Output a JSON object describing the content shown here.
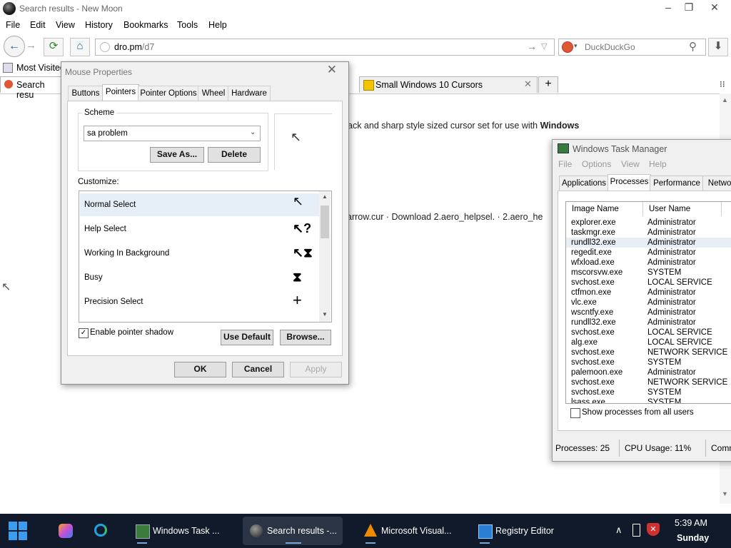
{
  "browser": {
    "title": "Search results - New Moon",
    "window_controls": {
      "minimize": "–",
      "restore": "❐",
      "close": "✕"
    },
    "menu": [
      "File",
      "Edit",
      "View",
      "History",
      "Bookmarks",
      "Tools",
      "Help"
    ],
    "url_host": "dro.pm",
    "url_path": "/d7",
    "search_engine": "DuckDuckGo",
    "bookmark_item": "Most Visited",
    "tabs": [
      {
        "label": "Search resu"
      },
      {
        "label": "Small Windows 10 Cursors"
      }
    ],
    "content_line1_prefix": "ack and sharp style sized cursor set for use with ",
    "content_line1_bold": "Windows",
    "content_line2": "arrow.cur · Download 2.aero_helpsel. · 2.aero_he"
  },
  "mouse_properties": {
    "title": "Mouse Properties",
    "tabs": [
      "Buttons",
      "Pointers",
      "Pointer Options",
      "Wheel",
      "Hardware"
    ],
    "active_tab": "Pointers",
    "scheme_label": "Scheme",
    "scheme_value": "sa problem",
    "save_as": "Save As...",
    "delete": "Delete",
    "customize_label": "Customize:",
    "cursor_rows": [
      {
        "label": "Normal Select",
        "glyph": "↖"
      },
      {
        "label": "Help Select",
        "glyph": "↖?"
      },
      {
        "label": "Working In Background",
        "glyph": "↖⧗"
      },
      {
        "label": "Busy",
        "glyph": "⧗"
      },
      {
        "label": "Precision Select",
        "glyph": "+"
      }
    ],
    "enable_shadow_label": "Enable pointer shadow",
    "enable_shadow_checked": true,
    "use_default": "Use Default",
    "browse": "Browse...",
    "ok": "OK",
    "cancel": "Cancel",
    "apply": "Apply"
  },
  "task_manager": {
    "title": "Windows Task Manager",
    "menu": [
      "File",
      "Options",
      "View",
      "Help"
    ],
    "tabs": [
      "Applications",
      "Processes",
      "Performance",
      "Networ"
    ],
    "active_tab": "Processes",
    "columns": [
      "Image Name",
      "User Name"
    ],
    "processes": [
      {
        "name": "explorer.exe",
        "user": "Administrator"
      },
      {
        "name": "taskmgr.exe",
        "user": "Administrator"
      },
      {
        "name": "rundll32.exe",
        "user": "Administrator"
      },
      {
        "name": "regedit.exe",
        "user": "Administrator"
      },
      {
        "name": "wfxload.exe",
        "user": "Administrator"
      },
      {
        "name": "mscorsvw.exe",
        "user": "SYSTEM"
      },
      {
        "name": "svchost.exe",
        "user": "LOCAL SERVICE"
      },
      {
        "name": "ctfmon.exe",
        "user": "Administrator"
      },
      {
        "name": "vlc.exe",
        "user": "Administrator"
      },
      {
        "name": "wscntfy.exe",
        "user": "Administrator"
      },
      {
        "name": "rundll32.exe",
        "user": "Administrator"
      },
      {
        "name": "svchost.exe",
        "user": "LOCAL SERVICE"
      },
      {
        "name": "alg.exe",
        "user": "LOCAL SERVICE"
      },
      {
        "name": "svchost.exe",
        "user": "NETWORK SERVICE"
      },
      {
        "name": "svchost.exe",
        "user": "SYSTEM"
      },
      {
        "name": "palemoon.exe",
        "user": "Administrator"
      },
      {
        "name": "svchost.exe",
        "user": "NETWORK SERVICE"
      },
      {
        "name": "svchost.exe",
        "user": "SYSTEM"
      },
      {
        "name": "lsass.exe",
        "user": "SYSTEM"
      }
    ],
    "selected_row": 2,
    "show_all_label": "Show processes from all users",
    "status_processes": "Processes: 25",
    "status_cpu": "CPU Usage: 11%",
    "status_commit": "Comm"
  },
  "taskbar": {
    "items": [
      {
        "label": "Windows Task ..."
      },
      {
        "label": "Search results -..."
      },
      {
        "label": "Microsoft Visual..."
      },
      {
        "label": "Registry Editor"
      }
    ],
    "time": "5:39 AM",
    "day": "Sunday"
  }
}
